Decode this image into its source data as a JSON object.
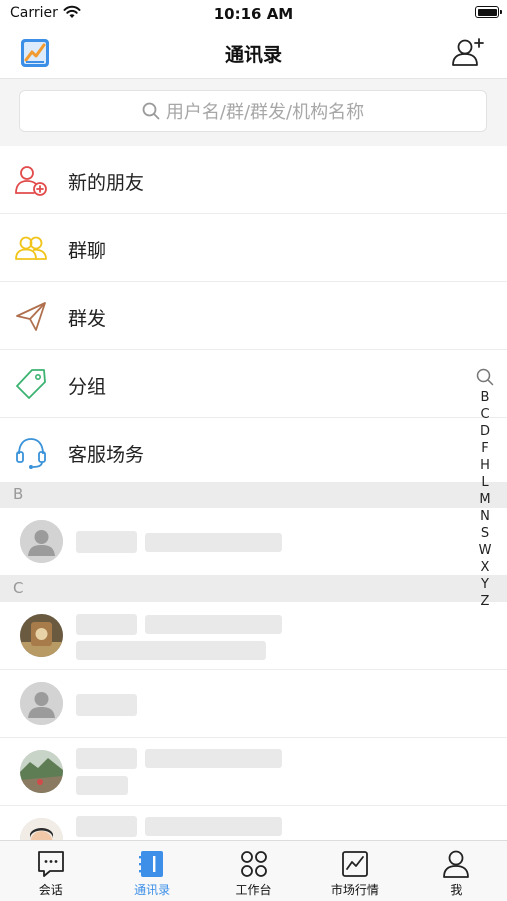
{
  "status_bar": {
    "carrier": "Carrier",
    "time": "10:16 AM"
  },
  "nav": {
    "title": "通讯录"
  },
  "search": {
    "placeholder": "用户名/群/群发/机构名称"
  },
  "functions": [
    {
      "label": "新的朋友",
      "icon": "new-friend-icon",
      "color": "#e24b4b"
    },
    {
      "label": "群聊",
      "icon": "group-chat-icon",
      "color": "#f0c419"
    },
    {
      "label": "群发",
      "icon": "paper-plane-icon",
      "color": "#b0704e"
    },
    {
      "label": "分组",
      "icon": "tag-icon",
      "color": "#3cb371"
    },
    {
      "label": "客服场务",
      "icon": "headset-icon",
      "color": "#3a92d8"
    }
  ],
  "sections": [
    "B",
    "C"
  ],
  "index_letters": [
    "B",
    "C",
    "D",
    "F",
    "H",
    "L",
    "M",
    "N",
    "S",
    "W",
    "X",
    "Y",
    "Z"
  ],
  "tabs": [
    {
      "label": "会话",
      "icon": "chat-icon"
    },
    {
      "label": "通讯录",
      "icon": "contacts-book-icon",
      "active": true
    },
    {
      "label": "工作台",
      "icon": "workbench-icon"
    },
    {
      "label": "市场行情",
      "icon": "market-chart-icon"
    },
    {
      "label": "我",
      "icon": "profile-icon"
    }
  ],
  "colors": {
    "accent": "#3d8fe8",
    "section_bg": "#ececec",
    "placeholder_bar": "#e9e9e9"
  }
}
